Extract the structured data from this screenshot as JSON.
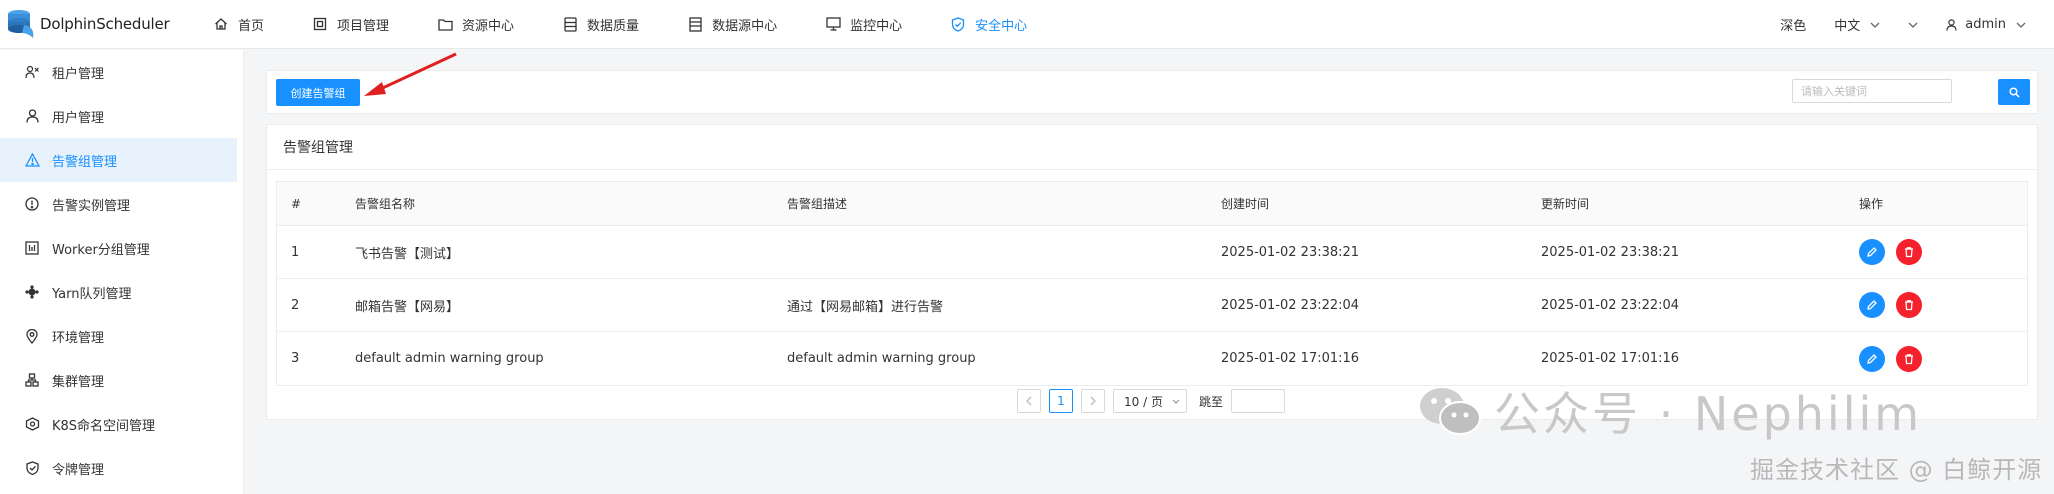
{
  "app": {
    "name": "DolphinScheduler"
  },
  "nav": [
    {
      "label": "首页",
      "icon": "home-icon"
    },
    {
      "label": "项目管理",
      "icon": "project-icon"
    },
    {
      "label": "资源中心",
      "icon": "folder-icon"
    },
    {
      "label": "数据质量",
      "icon": "data-quality-icon"
    },
    {
      "label": "数据源中心",
      "icon": "datasource-icon"
    },
    {
      "label": "监控中心",
      "icon": "monitor-icon"
    },
    {
      "label": "安全中心",
      "icon": "shield-icon",
      "active": true
    }
  ],
  "topRight": {
    "theme": "深色",
    "language": "中文",
    "user": "admin"
  },
  "sidebar": [
    {
      "label": "租户管理",
      "icon": "tenant-icon"
    },
    {
      "label": "用户管理",
      "icon": "user-icon"
    },
    {
      "label": "告警组管理",
      "icon": "warning-icon",
      "active": true
    },
    {
      "label": "告警实例管理",
      "icon": "alert-instance-icon"
    },
    {
      "label": "Worker分组管理",
      "icon": "worker-group-icon"
    },
    {
      "label": "Yarn队列管理",
      "icon": "yarn-queue-icon"
    },
    {
      "label": "环境管理",
      "icon": "environment-icon"
    },
    {
      "label": "集群管理",
      "icon": "cluster-icon"
    },
    {
      "label": "K8S命名空间管理",
      "icon": "k8s-namespace-icon"
    },
    {
      "label": "令牌管理",
      "icon": "token-icon"
    }
  ],
  "toolbar": {
    "create_label": "创建告警组",
    "search_placeholder": "请输入关键词"
  },
  "card": {
    "title": "告警组管理"
  },
  "table": {
    "columns": [
      "#",
      "告警组名称",
      "告警组描述",
      "创建时间",
      "更新时间",
      "操作"
    ],
    "rows": [
      [
        "1",
        "飞书告警【测试】",
        "",
        "2025-01-02 23:38:21",
        "2025-01-02 23:38:21"
      ],
      [
        "2",
        "邮箱告警【网易】",
        "通过【网易邮箱】进行告警",
        "2025-01-02 23:22:04",
        "2025-01-02 23:22:04"
      ],
      [
        "3",
        "default admin warning group",
        "default admin warning group",
        "2025-01-02 17:01:16",
        "2025-01-02 17:01:16"
      ]
    ]
  },
  "pagination": {
    "current": "1",
    "pageSize": "10 / 页",
    "jumpLabel": "跳至"
  },
  "watermark": {
    "line1": "公众号 · Nephilim",
    "line2": "掘金技术社区 @ 白鲸开源"
  },
  "colors": {
    "accent": "#1890ff",
    "danger": "#f5222d",
    "activeBg": "#e7f2fd"
  }
}
